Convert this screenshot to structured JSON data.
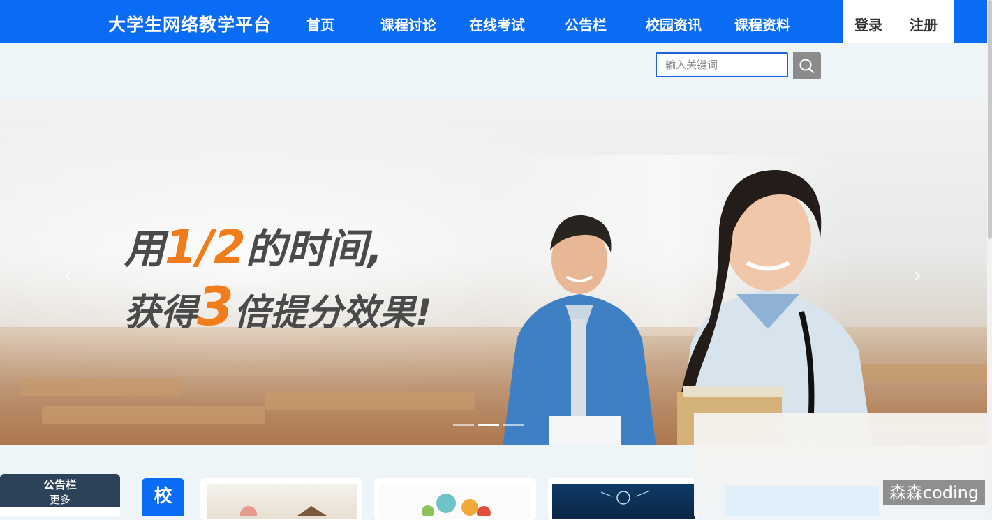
{
  "header": {
    "brand": "大学生网络教学平台",
    "nav": [
      "首页",
      "课程讨论",
      "在线考试",
      "公告栏",
      "校园资讯",
      "课程资料"
    ],
    "login": "登录",
    "register": "注册",
    "bg_color": "#0a6cf5"
  },
  "search": {
    "placeholder": "输入关键词",
    "icon": "search-icon"
  },
  "banner": {
    "line1_pre": "用",
    "line1_hl": "1/2",
    "line1_post": "的时间,",
    "line2_pre": "获得",
    "line2_hl": "3",
    "line2_post": "倍提分效果!",
    "prev_icon": "chevron-left-icon",
    "next_icon": "chevron-right-icon",
    "slide_count": 3,
    "active_slide": 2
  },
  "sections": {
    "notice_title": "公告栏",
    "notice_more": "更多",
    "campus_tag": "校"
  },
  "watermark": "森森coding"
}
